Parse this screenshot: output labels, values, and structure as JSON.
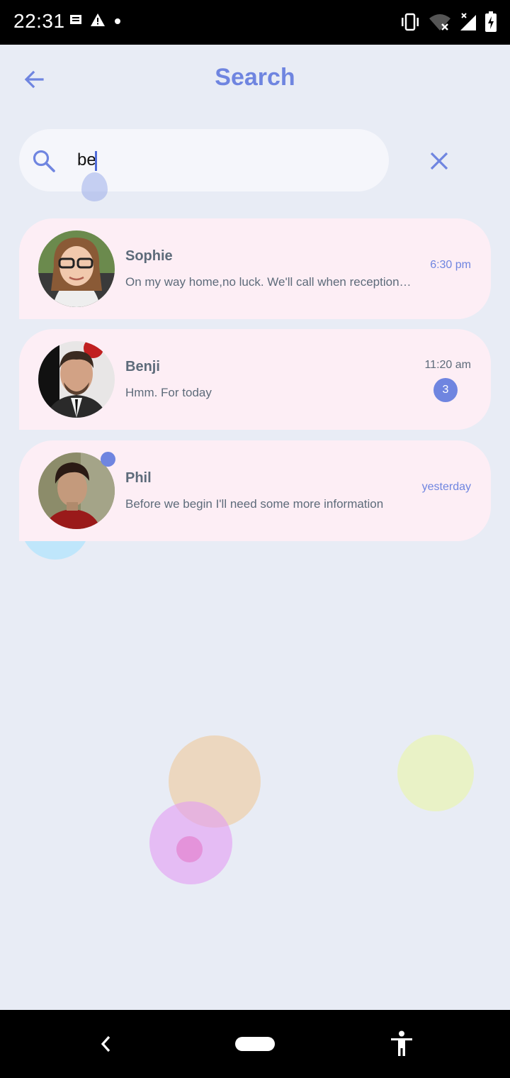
{
  "status_bar": {
    "time": "22:31"
  },
  "header": {
    "title": "Search"
  },
  "search": {
    "value": "be",
    "placeholder": ""
  },
  "chats": [
    {
      "name": "Sophie",
      "message": "On my way home,no luck. We'll call when reception …",
      "time": "6:30 pm",
      "unread": "",
      "online": false
    },
    {
      "name": "Benji",
      "message": "Hmm. For today",
      "time": "11:20 am",
      "unread": "3",
      "online": false
    },
    {
      "name": "Phil",
      "message": "Before we begin I'll need some more information",
      "time": "yesterday",
      "unread": "",
      "online": true
    }
  ],
  "colors": {
    "accent": "#6f85e0",
    "background": "#e8ecf5",
    "card": "#fdeef5",
    "text": "#5d6b7a"
  }
}
